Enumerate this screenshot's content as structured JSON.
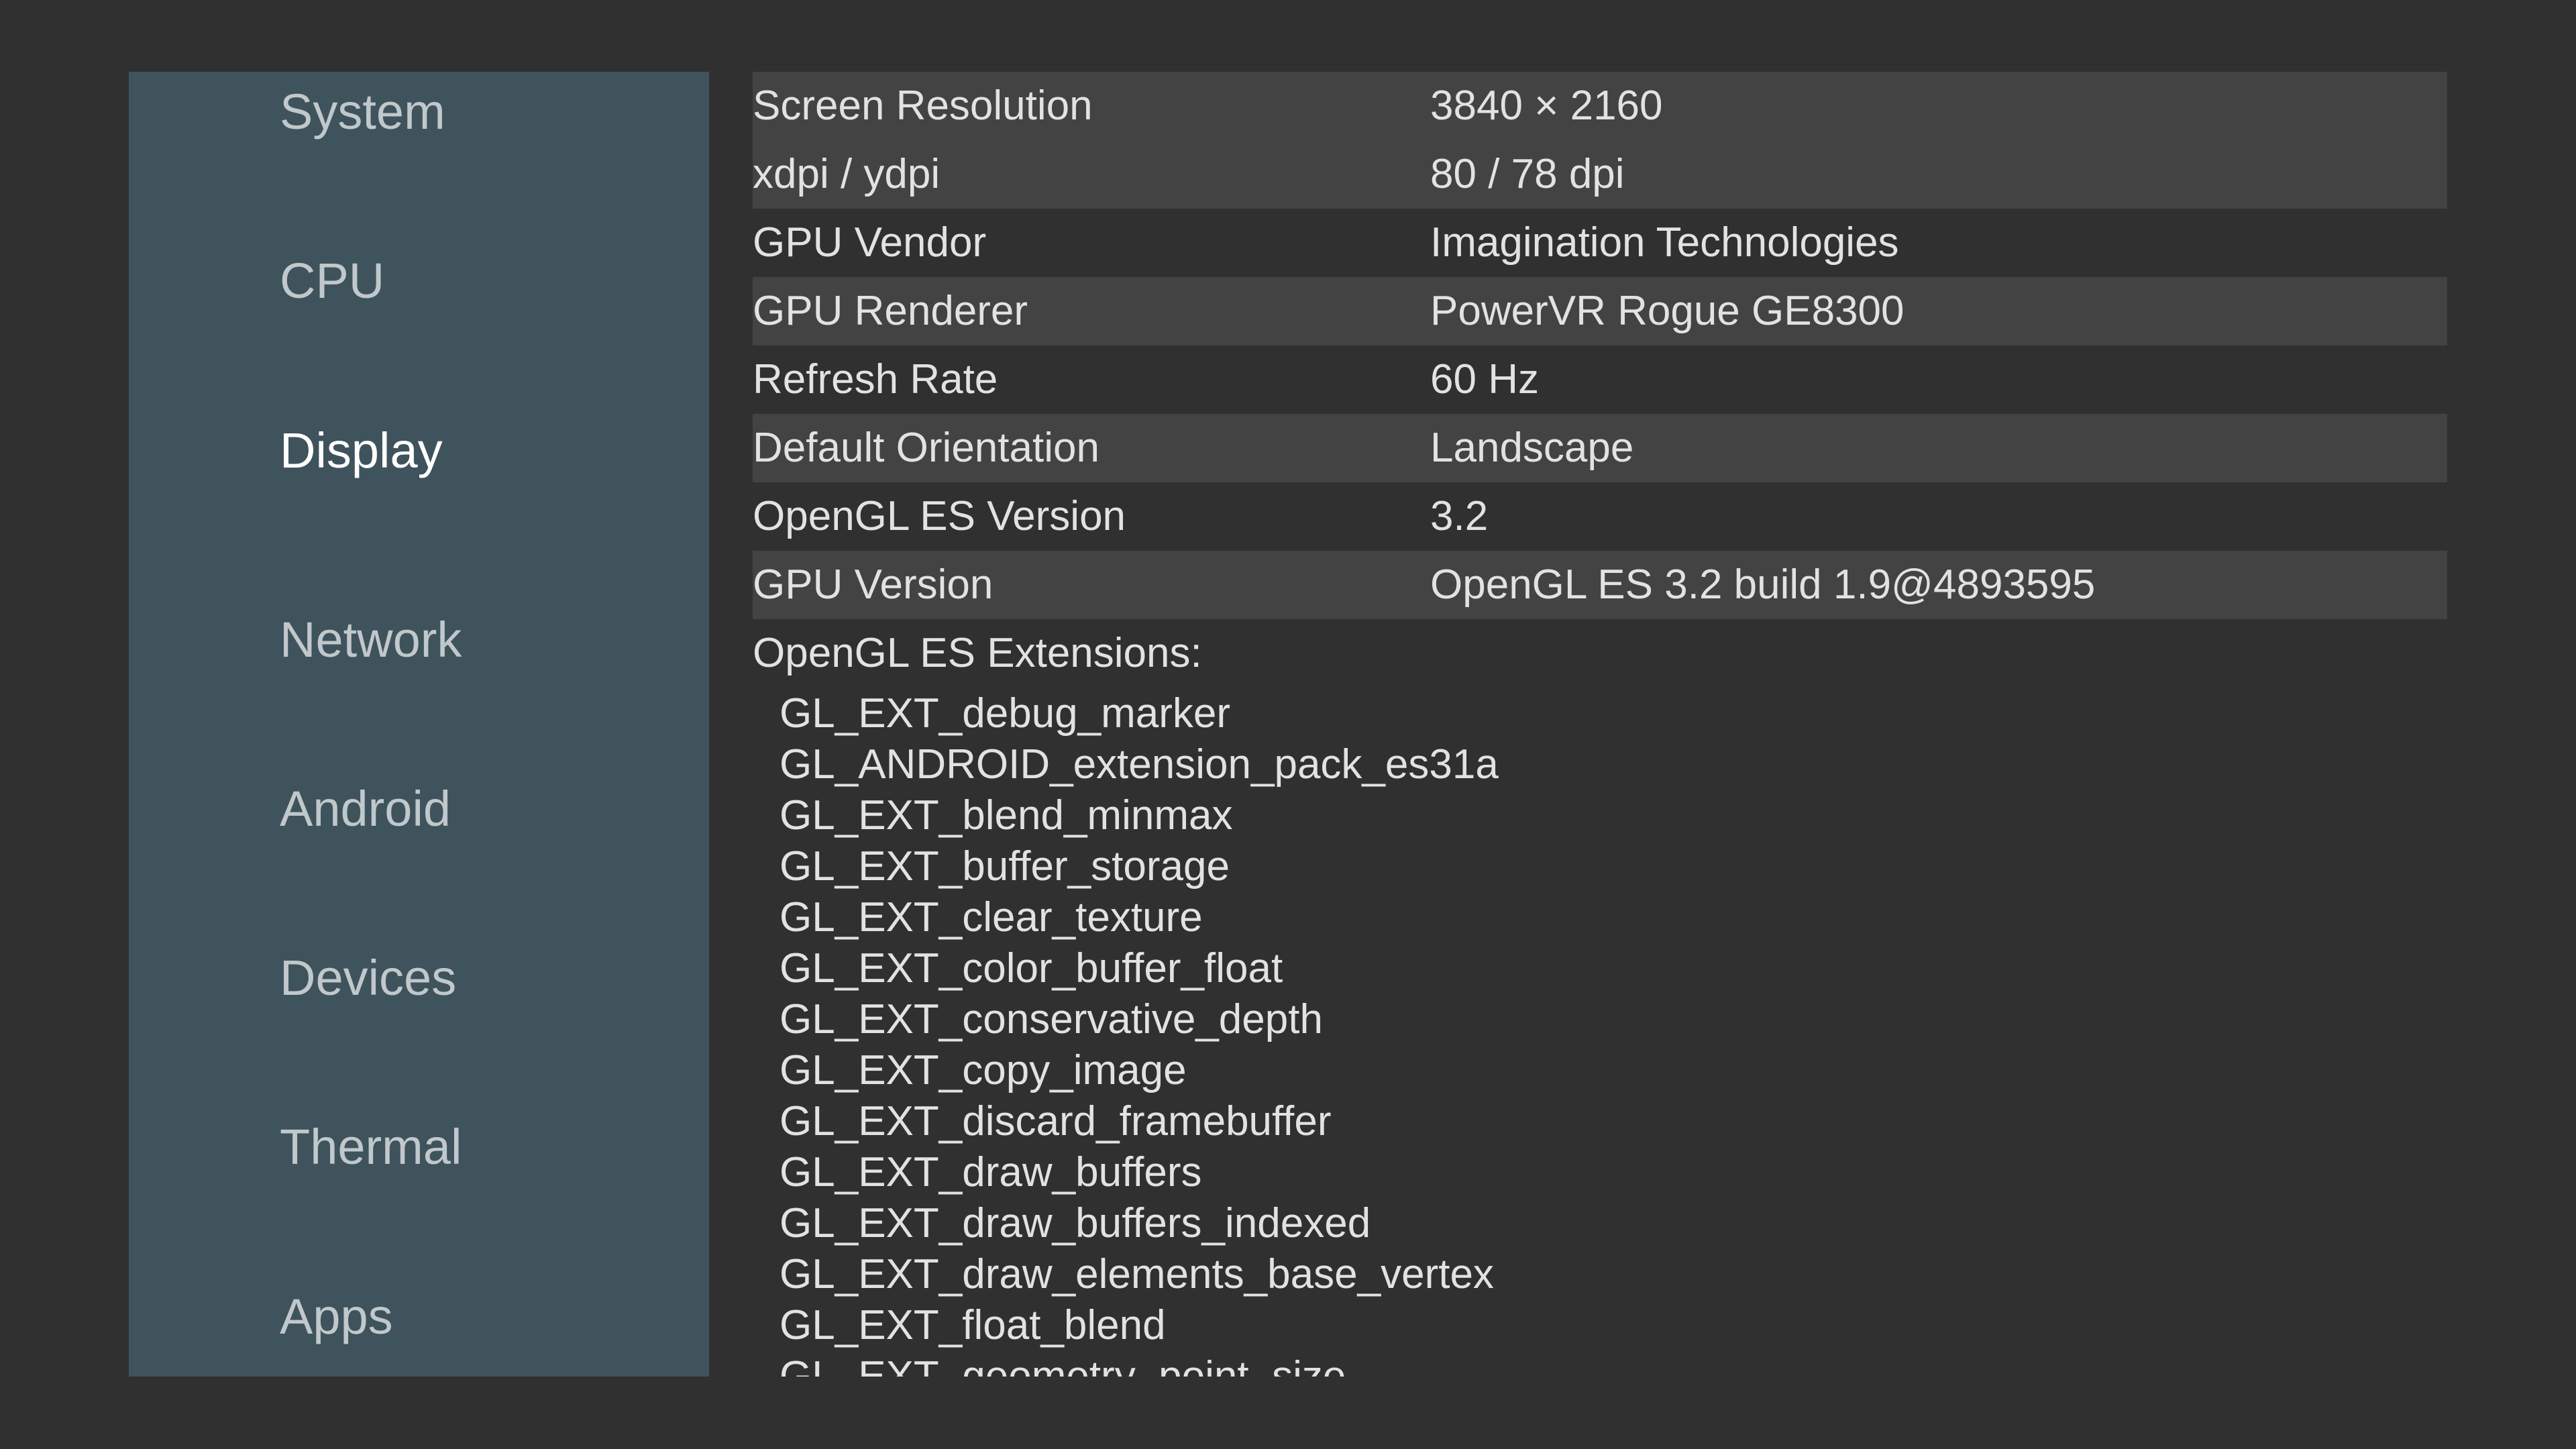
{
  "sidebar": {
    "items": [
      {
        "label": "System"
      },
      {
        "label": "CPU"
      },
      {
        "label": "Display",
        "active": true
      },
      {
        "label": "Network"
      },
      {
        "label": "Android"
      },
      {
        "label": "Devices"
      },
      {
        "label": "Thermal"
      },
      {
        "label": "Apps"
      }
    ]
  },
  "display": {
    "rows": [
      {
        "key": "Screen Resolution",
        "value": "3840 × 2160"
      },
      {
        "key": "xdpi / ydpi",
        "value": "80 / 78 dpi"
      },
      {
        "key": "GPU Vendor",
        "value": "Imagination Technologies"
      },
      {
        "key": "GPU Renderer",
        "value": "PowerVR Rogue GE8300"
      },
      {
        "key": "Refresh Rate",
        "value": "60 Hz"
      },
      {
        "key": "Default Orientation",
        "value": "Landscape"
      },
      {
        "key": "OpenGL ES Version",
        "value": "3.2"
      },
      {
        "key": "GPU Version",
        "value": "OpenGL ES 3.2 build 1.9@4893595"
      }
    ],
    "extensions_title": "OpenGL ES Extensions:",
    "extensions": [
      "GL_EXT_debug_marker",
      "GL_ANDROID_extension_pack_es31a",
      "GL_EXT_blend_minmax",
      "GL_EXT_buffer_storage",
      "GL_EXT_clear_texture",
      "GL_EXT_color_buffer_float",
      "GL_EXT_conservative_depth",
      "GL_EXT_copy_image",
      "GL_EXT_discard_framebuffer",
      "GL_EXT_draw_buffers",
      "GL_EXT_draw_buffers_indexed",
      "GL_EXT_draw_elements_base_vertex",
      "GL_EXT_float_blend",
      "GL_EXT_geometry_point_size"
    ]
  },
  "colors": {
    "background": "#303030",
    "sidebar": "#3f535c",
    "row_shade": "#434343",
    "text": "#e2e2e2",
    "nav_text": "#c0c8cb",
    "nav_active": "#ffffff"
  }
}
